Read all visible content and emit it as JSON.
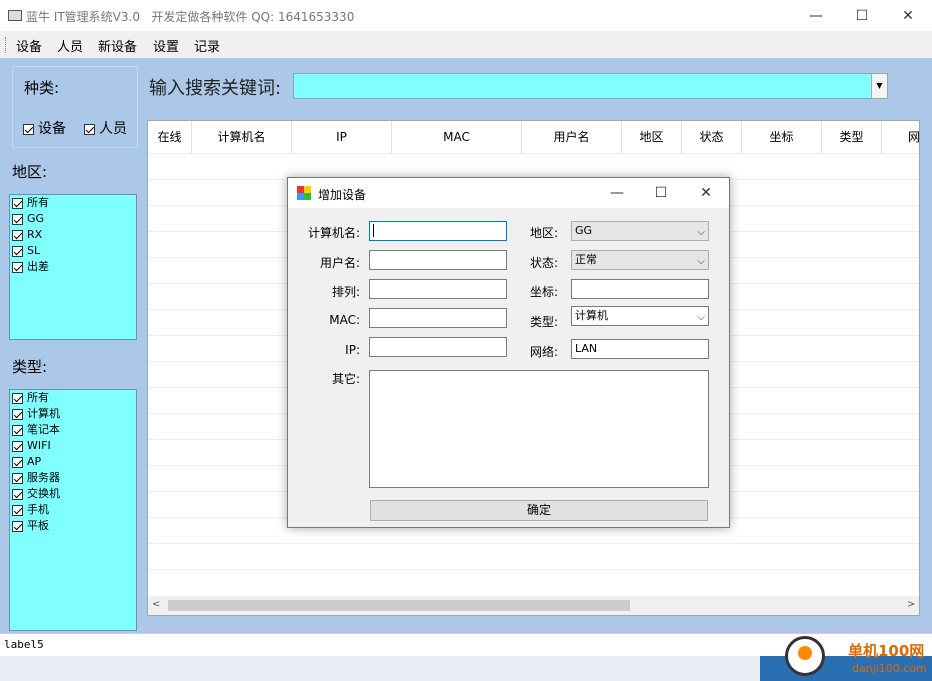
{
  "window": {
    "title": "蓝牛 IT管理系统V3.0   开发定做各种软件 QQ: 1641653330",
    "min_label": "—",
    "max_label": "☐",
    "close_label": "✕"
  },
  "menu": [
    "设备",
    "人员",
    "新设备",
    "设置",
    "记录"
  ],
  "category": {
    "label": "种类:",
    "options": [
      {
        "label": "设备",
        "checked": true
      },
      {
        "label": "人员",
        "checked": true
      }
    ]
  },
  "search": {
    "label": "输入搜索关键词:",
    "value": ""
  },
  "region": {
    "label": "地区:",
    "items": [
      "所有",
      "GG",
      "RX",
      "SL",
      "出差"
    ]
  },
  "type_filter": {
    "label": "类型:",
    "items": [
      "所有",
      "计算机",
      "笔记本",
      "WIFI",
      "AP",
      "服务器",
      "交换机",
      "手机",
      "平板"
    ]
  },
  "grid": {
    "columns": [
      "在线",
      "计算机名",
      "IP",
      "MAC",
      "用户名",
      "地区",
      "状态",
      "坐标",
      "类型",
      "网"
    ]
  },
  "statusbar": {
    "text": "label5"
  },
  "dialog": {
    "title": "增加设备",
    "fields": {
      "computer_name": {
        "label": "计算机名:",
        "value": ""
      },
      "user_name": {
        "label": "用户名:",
        "value": ""
      },
      "order": {
        "label": "排列:",
        "value": ""
      },
      "mac": {
        "label": "MAC:",
        "value": ""
      },
      "ip": {
        "label": "IP:",
        "value": ""
      },
      "other": {
        "label": "其它:",
        "value": ""
      },
      "region": {
        "label": "地区:",
        "value": "GG"
      },
      "status": {
        "label": "状态:",
        "value": "正常"
      },
      "coord": {
        "label": "坐标:",
        "value": ""
      },
      "type": {
        "label": "类型:",
        "value": "计算机"
      },
      "network": {
        "label": "网络:",
        "value": "LAN"
      }
    },
    "confirm_label": "确定"
  },
  "watermark": {
    "text": "单机100网",
    "sub": "danji100.com"
  },
  "colors": {
    "accent_cyan": "#80ffff",
    "panel_blue": "#abc8e8",
    "search_bg": "#7fffff"
  }
}
